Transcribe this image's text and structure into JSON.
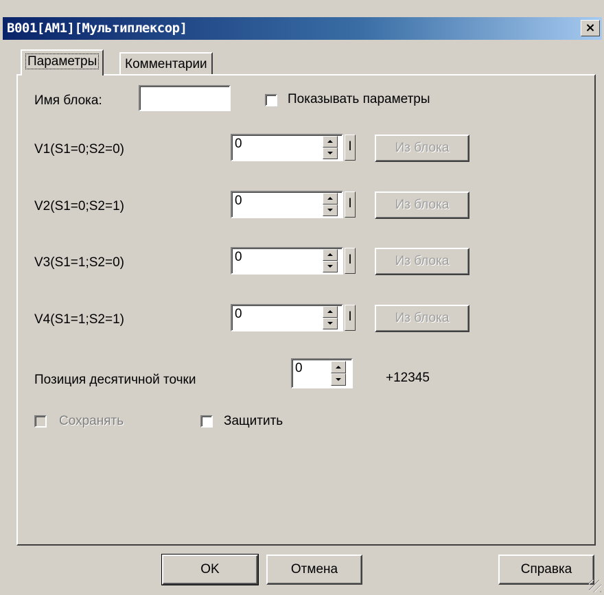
{
  "window": {
    "title": "B001[AM1][Мультиплексор]",
    "close_label": "×"
  },
  "tabs": [
    {
      "label": "Параметры",
      "active": true
    },
    {
      "label": "Комментарии",
      "active": false
    }
  ],
  "form": {
    "block_name_label": "Имя блока:",
    "block_name_value": "",
    "show_params_label": "Показывать параметры",
    "rows": [
      {
        "label": "V1(S1=0;S2=0)",
        "value": "0",
        "i_label": "I",
        "from_block_label": "Из блока"
      },
      {
        "label": "V2(S1=0;S2=1)",
        "value": "0",
        "i_label": "I",
        "from_block_label": "Из блока"
      },
      {
        "label": "V3(S1=1;S2=0)",
        "value": "0",
        "i_label": "I",
        "from_block_label": "Из блока"
      },
      {
        "label": "V4(S1=1;S2=1)",
        "value": "0",
        "i_label": "I",
        "from_block_label": "Из блока"
      }
    ],
    "decimal_label": "Позиция десятичной точки",
    "decimal_value": "0",
    "decimal_preview": "+12345",
    "save_label": "Сохранять",
    "protect_label": "Защитить"
  },
  "buttons": {
    "ok": "OK",
    "cancel": "Отмена",
    "help": "Справка"
  },
  "colors": {
    "face": "#d4d0c8",
    "title_start": "#0a246a",
    "title_end": "#a6caf0"
  }
}
